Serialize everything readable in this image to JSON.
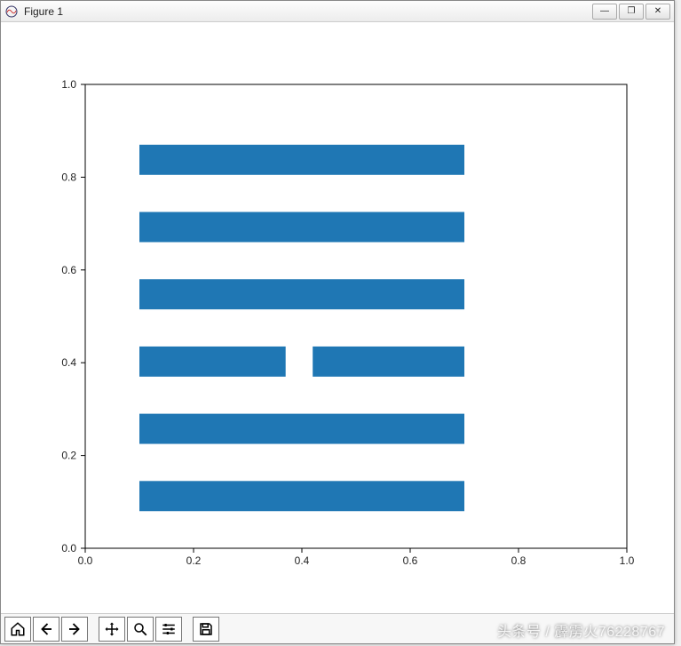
{
  "window": {
    "title": "Figure 1",
    "btn_min": "—",
    "btn_max": "❐",
    "btn_close": "✕"
  },
  "toolbar": {
    "home": "home-icon",
    "back": "back-icon",
    "forward": "forward-icon",
    "pan": "pan-icon",
    "zoom": "zoom-icon",
    "configure": "configure-icon",
    "save": "save-icon"
  },
  "watermark": "头条号 / 霹雳火76228767",
  "chart_data": {
    "type": "bar",
    "orientation": "horizontal",
    "xlim": [
      0.0,
      1.0
    ],
    "ylim": [
      0.0,
      1.0
    ],
    "xticks": [
      0.0,
      0.2,
      0.4,
      0.6,
      0.8,
      1.0
    ],
    "yticks": [
      0.0,
      0.2,
      0.4,
      0.6,
      0.8,
      1.0
    ],
    "xtick_labels": [
      "0.0",
      "0.2",
      "0.4",
      "0.6",
      "0.8",
      "1.0"
    ],
    "ytick_labels": [
      "0.0",
      "0.2",
      "0.4",
      "0.6",
      "0.8",
      "1.0"
    ],
    "bar_color": "#1f77b4",
    "bars": [
      {
        "x": 0.1,
        "y": 0.08,
        "w": 0.6,
        "h": 0.065
      },
      {
        "x": 0.1,
        "y": 0.225,
        "w": 0.6,
        "h": 0.065
      },
      {
        "x": 0.1,
        "y": 0.37,
        "w": 0.27,
        "h": 0.065
      },
      {
        "x": 0.42,
        "y": 0.37,
        "w": 0.28,
        "h": 0.065
      },
      {
        "x": 0.1,
        "y": 0.515,
        "w": 0.6,
        "h": 0.065
      },
      {
        "x": 0.1,
        "y": 0.66,
        "w": 0.6,
        "h": 0.065
      },
      {
        "x": 0.1,
        "y": 0.805,
        "w": 0.6,
        "h": 0.065
      }
    ],
    "title": "",
    "xlabel": "",
    "ylabel": ""
  }
}
